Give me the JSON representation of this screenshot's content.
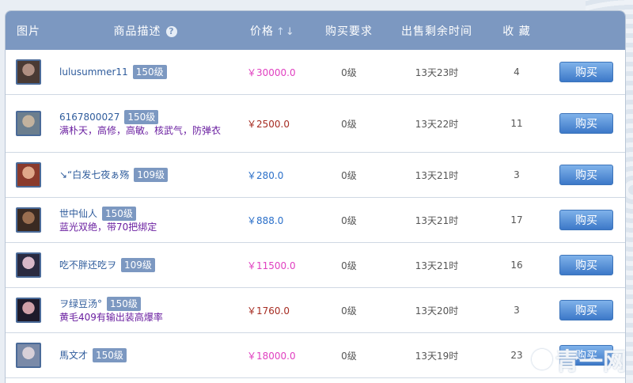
{
  "header": {
    "image": "图片",
    "desc": "商品描述",
    "help": "?",
    "price": "价格",
    "sort_up": "↑",
    "sort_down": "↓",
    "requirement": "购买要求",
    "time_left": "出售剩余时间",
    "favorites": "收 藏"
  },
  "rows": [
    {
      "seller": "lulusummer11",
      "level": "150级",
      "extra": "",
      "price": "￥30000.0",
      "req": "0级",
      "time": "13天23时",
      "fav": "4",
      "buy": "购买",
      "price_color": "pink",
      "avatar_colors": [
        "#4a3a34",
        "#b08f82"
      ]
    },
    {
      "seller": "6167800027",
      "level": "150级",
      "extra": "满朴天，高修，高敏。核武气，防弹衣",
      "price": "￥2500.0",
      "req": "0级",
      "time": "13天22时",
      "fav": "11",
      "buy": "购买",
      "price_color": "red",
      "avatar_colors": [
        "#6b7e8e",
        "#c2b29e"
      ]
    },
    {
      "seller": "↘“白发七夜ぁ殇",
      "level": "109级",
      "extra": "",
      "price": "￥280.0",
      "req": "0级",
      "time": "13天21时",
      "fav": "3",
      "buy": "购买",
      "price_color": "blue",
      "avatar_colors": [
        "#8a3a2c",
        "#e0a88a"
      ]
    },
    {
      "seller": "世中仙人",
      "level": "150级",
      "extra": "蓝光双绝，带70把绑定",
      "price": "￥888.0",
      "req": "0级",
      "time": "13天21时",
      "fav": "17",
      "buy": "购买",
      "price_color": "blue",
      "avatar_colors": [
        "#3a2a22",
        "#9a6e50"
      ]
    },
    {
      "seller": "吃不胖还吃ヲ",
      "level": "109级",
      "extra": "",
      "price": "￥11500.0",
      "req": "0级",
      "time": "13天21时",
      "fav": "16",
      "buy": "购买",
      "price_color": "pink",
      "avatar_colors": [
        "#2a2a40",
        "#d8b8c8"
      ]
    },
    {
      "seller": "ヲ绿豆汤°",
      "level": "150级",
      "extra": "黄毛409有输出装高爆率",
      "price": "￥1760.0",
      "req": "0级",
      "time": "13天20时",
      "fav": "3",
      "buy": "购买",
      "price_color": "red",
      "avatar_colors": [
        "#1e1a2a",
        "#d0a0a8"
      ]
    },
    {
      "seller": "馬文才",
      "level": "150级",
      "extra": "",
      "price": "￥18000.0",
      "req": "0级",
      "time": "13天19时",
      "fav": "23",
      "buy": "购买",
      "price_color": "pink",
      "avatar_colors": [
        "#7a8aa8",
        "#d8d0d8"
      ]
    }
  ],
  "watermark": "青一网"
}
